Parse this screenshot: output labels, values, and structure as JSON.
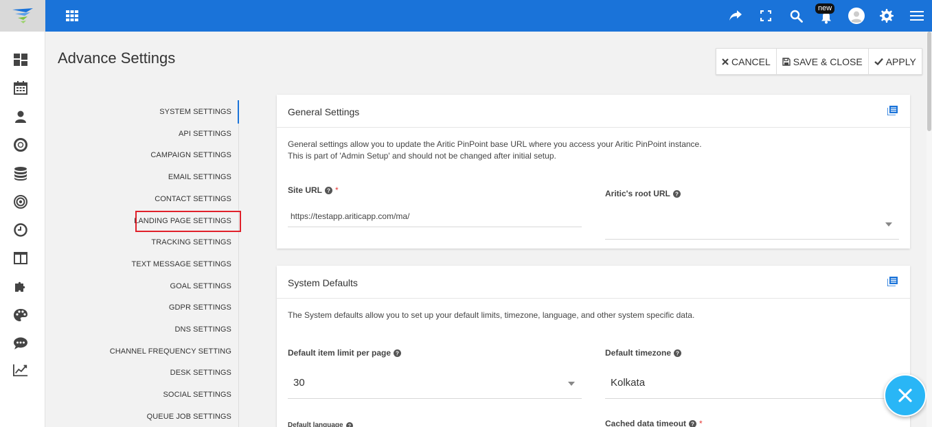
{
  "topbar": {
    "new_badge": "new",
    "icons": [
      "share-icon",
      "fullscreen-icon",
      "search-icon",
      "bell-icon",
      "avatar",
      "gear-icon",
      "hamburger-icon"
    ],
    "color": "#1a73d9"
  },
  "leftnav": {
    "icons": [
      "dashboard-icon",
      "calendar-icon",
      "user-icon",
      "lifebuoy-icon",
      "database-icon",
      "target-icon",
      "clock-icon",
      "layout-icon",
      "puzzle-icon",
      "palette-icon",
      "chat-icon",
      "chart-line-icon"
    ]
  },
  "page": {
    "title": "Advance Settings"
  },
  "actions": {
    "cancel": "CANCEL",
    "save_close": "SAVE & CLOSE",
    "apply": "APPLY"
  },
  "settings_menu": {
    "items": [
      "SYSTEM SETTINGS",
      "API SETTINGS",
      "CAMPAIGN SETTINGS",
      "EMAIL SETTINGS",
      "CONTACT SETTINGS",
      "LANDING PAGE SETTINGS",
      "TRACKING SETTINGS",
      "TEXT MESSAGE SETTINGS",
      "GOAL SETTINGS",
      "GDPR SETTINGS",
      "DNS SETTINGS",
      "CHANNEL FREQUENCY SETTING",
      "DESK SETTINGS",
      "SOCIAL SETTINGS",
      "QUEUE JOB SETTINGS"
    ],
    "active": "SYSTEM SETTINGS",
    "highlighted": "LANDING PAGE SETTINGS"
  },
  "general_settings": {
    "title": "General Settings",
    "desc_line1": "General settings allow you to update the Aritic PinPoint base URL where you access your Aritic PinPoint instance.",
    "desc_line2": "This is part of 'Admin Setup' and should not be changed after initial setup.",
    "site_url_label": "Site URL",
    "site_url_required": "*",
    "site_url_value": "https://testapp.ariticapp.com/ma/",
    "root_url_label": "Aritic's root URL",
    "root_url_value": ""
  },
  "system_defaults": {
    "title": "System Defaults",
    "desc": "The System defaults allow you to set up your default limits, timezone, language, and other system specific data.",
    "item_limit_label": "Default item limit per page",
    "item_limit_value": "30",
    "timezone_label": "Default timezone",
    "timezone_value": "Kolkata",
    "language_label": "Default language",
    "cache_label": "Cached data timeout",
    "cache_required": "*"
  },
  "colors": {
    "accent": "#1a73d9",
    "fab": "#29b6f6",
    "highlight": "#e0202a"
  }
}
